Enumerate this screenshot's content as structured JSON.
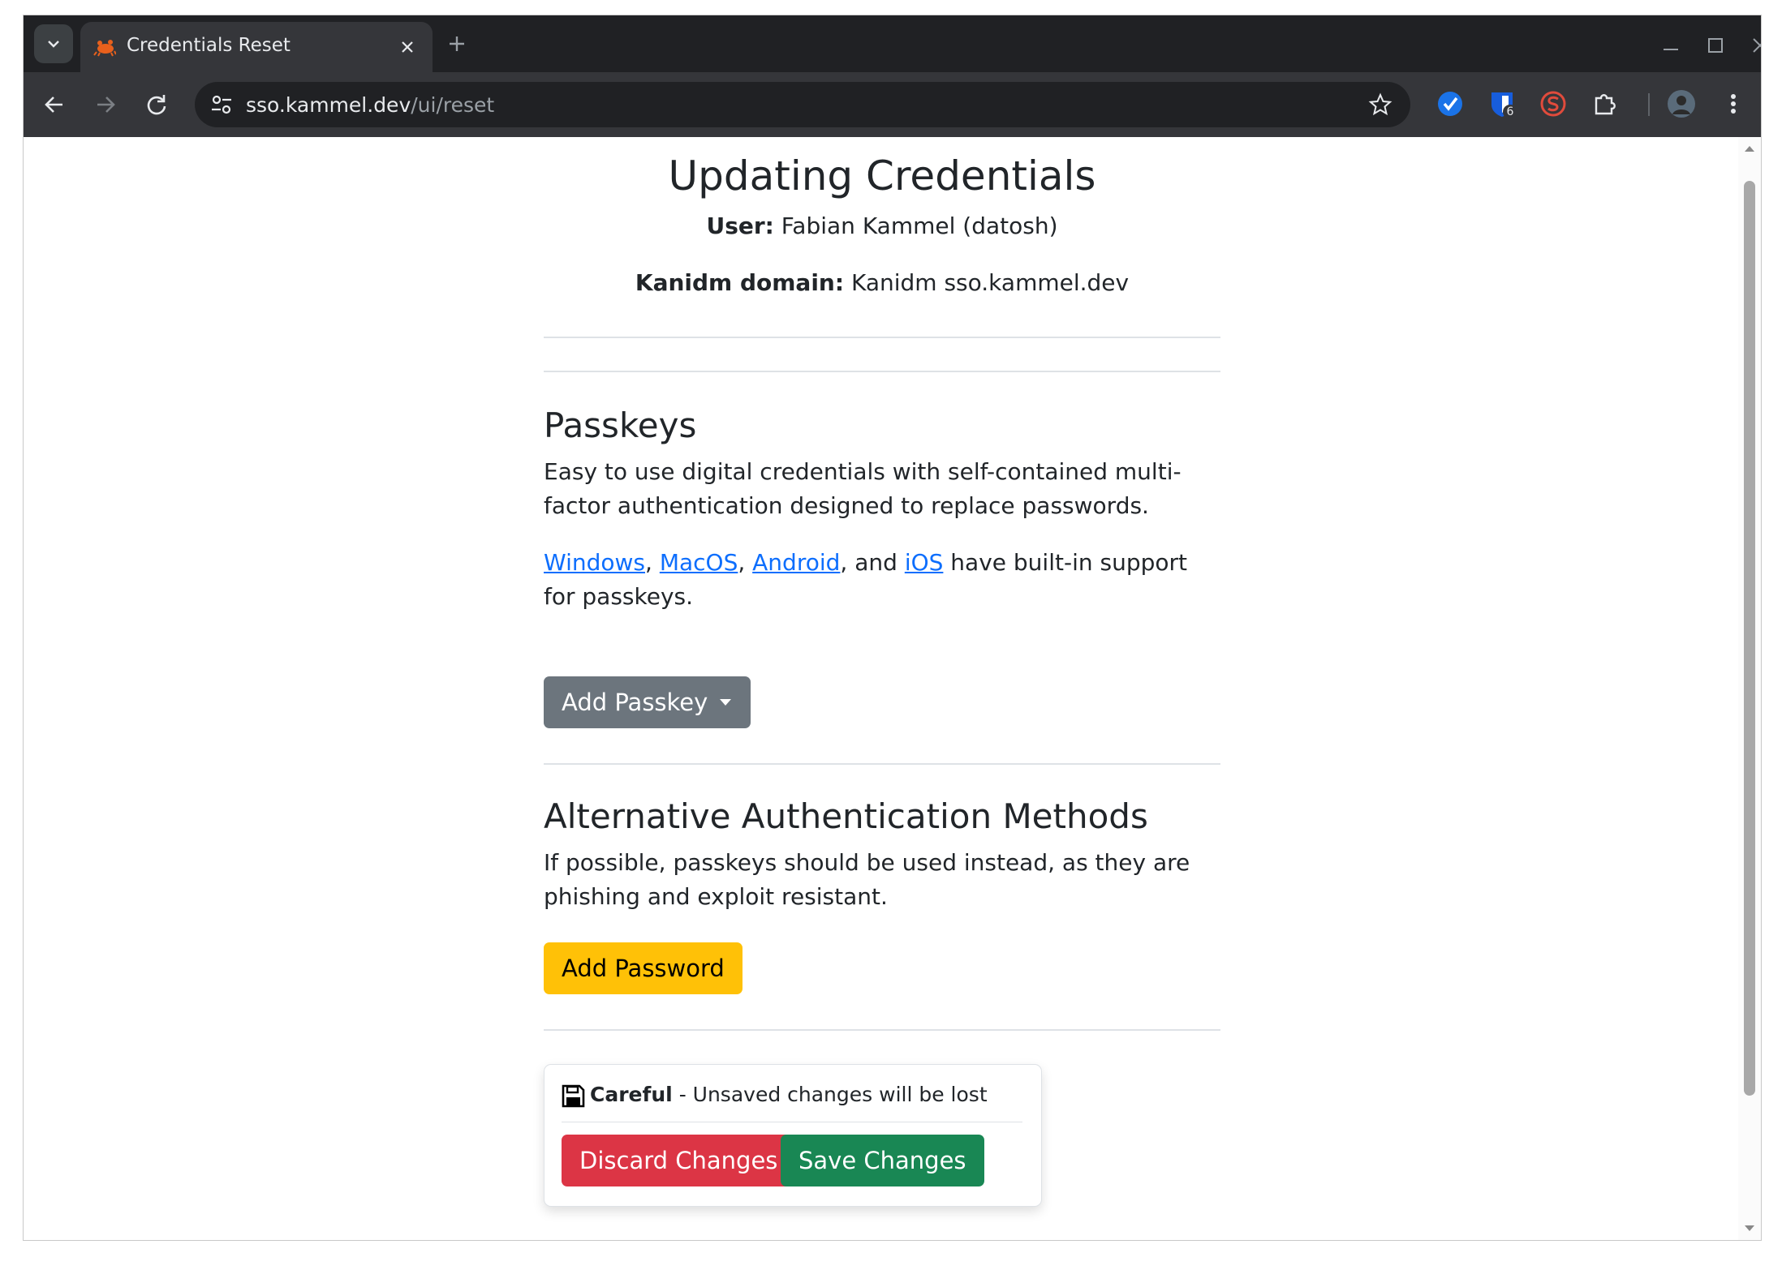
{
  "browser": {
    "tab_title": "Credentials Reset",
    "url_host": "sso.kammel.dev",
    "url_path": "/ui/reset",
    "extension_badge": "6"
  },
  "page": {
    "title": "Updating Credentials",
    "user_label": "User:",
    "user_value": "Fabian Kammel (datosh)",
    "domain_label": "Kanidm domain:",
    "domain_value": "Kanidm sso.kammel.dev"
  },
  "passkeys": {
    "heading": "Passkeys",
    "description": "Easy to use digital credentials with self-contained multi-factor authentication designed to replace passwords.",
    "links": [
      "Windows",
      "MacOS",
      "Android",
      "iOS"
    ],
    "sep1": ", ",
    "sep2": ", ",
    "sep3": ", and ",
    "support_text": " have built-in support for passkeys.",
    "add_button": "Add Passkey"
  },
  "alternative": {
    "heading": "Alternative Authentication Methods",
    "description": "If possible, passkeys should be used instead, as they are phishing and exploit resistant.",
    "add_password_button": "Add Password"
  },
  "unsaved": {
    "careful": "Careful",
    "message": " - Unsaved changes will be lost",
    "discard_button": "Discard Changes",
    "save_button": "Save Changes"
  },
  "colors": {
    "secondary": "#6c757d",
    "warning": "#ffc107",
    "danger": "#dc3545",
    "success": "#198754",
    "link": "#0d6efd"
  }
}
